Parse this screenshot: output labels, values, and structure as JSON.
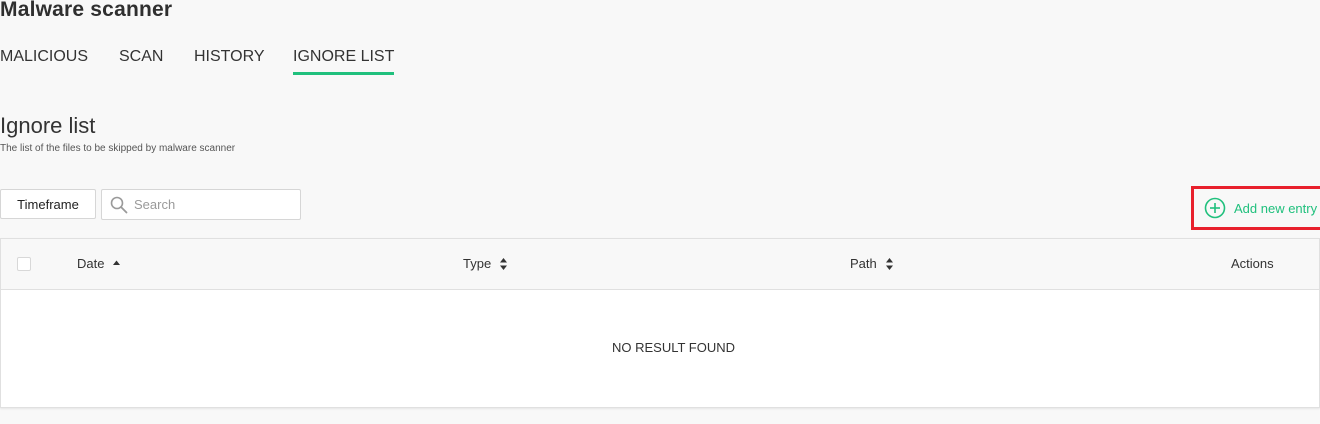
{
  "app": {
    "title": "Malware scanner"
  },
  "tabs": [
    {
      "label": "MALICIOUS",
      "active": false
    },
    {
      "label": "SCAN",
      "active": false
    },
    {
      "label": "HISTORY",
      "active": false
    },
    {
      "label": "IGNORE LIST",
      "active": true
    }
  ],
  "section": {
    "title": "Ignore list",
    "subtitle": "The list of the files to be skipped by malware scanner"
  },
  "toolbar": {
    "timeframe_label": "Timeframe",
    "search_placeholder": "Search",
    "search_value": "",
    "add_entry_label": "Add new entry"
  },
  "table": {
    "columns": [
      {
        "label": "Date",
        "sort": "ascending"
      },
      {
        "label": "Type",
        "sort": "none"
      },
      {
        "label": "Path",
        "sort": "none"
      },
      {
        "label": "Actions",
        "sort": null
      }
    ],
    "rows": [],
    "empty_message": "NO RESULT FOUND"
  },
  "colors": {
    "accent": "#20c07d",
    "highlight_border": "#e8202c",
    "background": "#f8f8f8",
    "text": "#333333"
  },
  "icons": {
    "search": "search-icon",
    "add": "plus-circle-icon",
    "sort_ascending": "sort-ascending-icon",
    "sort_both": "sort-both-icon"
  }
}
